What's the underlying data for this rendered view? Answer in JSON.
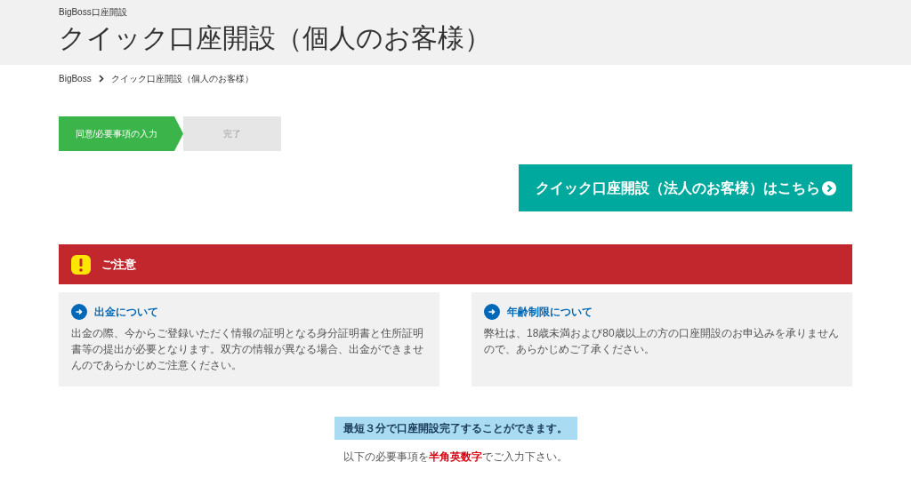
{
  "header": {
    "site_label": "BigBoss口座開設",
    "title": "クイック口座開設（個人のお客様）"
  },
  "breadcrumb": [
    "BigBoss",
    "クイック口座開設（個人のお客様）"
  ],
  "steps": [
    {
      "label": "同意/必要事項の入力",
      "selected": true
    },
    {
      "label": "完了",
      "selected": false
    }
  ],
  "corporate_button": "クイック口座開設（法人のお客様）はこちら",
  "notice": {
    "title": "ご注意",
    "cards": [
      {
        "heading": "出金について",
        "body": "出金の際、今からご登録いただく情報の証明となる身分証明書と住所証明書等の提出が必要となります。双方の情報が異なる場合、出金ができませんのであらかじめご注意ください。"
      },
      {
        "heading": "年齢制限について",
        "body": "弊社は、18歳未満および80歳以上の方の口座開設のお申込みを承りませんので、あらかじめご了承ください。"
      }
    ]
  },
  "info_banner": "最短３分で口座開設完了することができます。",
  "instruction": {
    "before": "以下の必要事項を",
    "highlight": "半角英数字",
    "after": "でご入力下さい。"
  }
}
